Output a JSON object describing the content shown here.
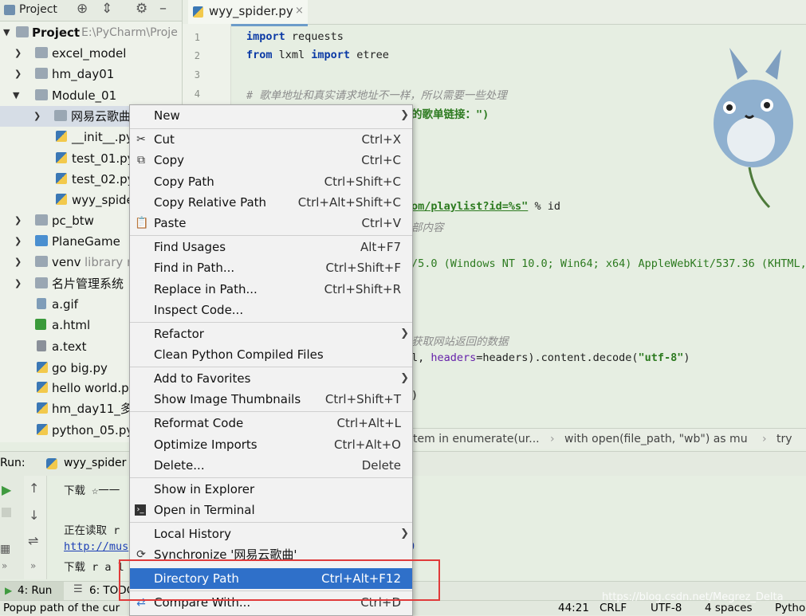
{
  "project_panel": {
    "title": "Project",
    "root_label": "Project",
    "root_path": "E:\\PyCharm\\Proje",
    "items": [
      {
        "label": "excel_model",
        "kind": "folder"
      },
      {
        "label": "hm_day01",
        "kind": "folder"
      },
      {
        "label": "Module_01",
        "kind": "folder"
      },
      {
        "label": "网易云歌曲",
        "kind": "folder"
      },
      {
        "label": "__init__.py",
        "kind": "py"
      },
      {
        "label": "test_01.py",
        "kind": "py"
      },
      {
        "label": "test_02.py",
        "kind": "py"
      },
      {
        "label": "wyy_spide",
        "kind": "py"
      },
      {
        "label": "pc_btw",
        "kind": "folder"
      },
      {
        "label": "PlaneGame",
        "kind": "folder"
      },
      {
        "label": "venv",
        "kind": "folder",
        "note": "library r"
      },
      {
        "label": "名片管理系统",
        "kind": "folder"
      },
      {
        "label": "a.gif",
        "kind": "file"
      },
      {
        "label": "a.html",
        "kind": "file"
      },
      {
        "label": "a.text",
        "kind": "file"
      },
      {
        "label": "go big.py",
        "kind": "py"
      },
      {
        "label": "hello world.p",
        "kind": "py"
      },
      {
        "label": "hm_day11_多",
        "kind": "py"
      },
      {
        "label": "python_05.py",
        "kind": "py"
      }
    ]
  },
  "editor": {
    "tab_label": "wyy_spider.py",
    "line_numbers": [
      "1",
      "2",
      "3",
      "4"
    ],
    "code": {
      "l1_kw": "import",
      "l1_rest": " requests",
      "l2_kw1": "from",
      "l2_mid": " lxml ",
      "l2_kw2": "import",
      "l2_rest": " etree",
      "l4_comment": "# 歌单地址和真实请求地址不一样，所以需要一些处理",
      "l5_partial": "的歌单链接：\")",
      "l9_url": "om/playlist?id=%s\"",
      "l9_rest": " % id",
      "l10_comment": "部内容",
      "l12_partial": "/5.0 (Windows NT 10.0; Win64; x64) AppleWebKit/537.36 (KHTML,",
      "l15_comment": "获取网站返回的数据",
      "l16_a": "l, ",
      "l16_prm": "headers",
      "l16_b": "=headers).content.decode(",
      "l16_str": "\"utf-8\"",
      "l16_c": ")",
      "l18_partial": ")"
    },
    "breadcrumb": [
      "tem in enumerate(ur...",
      "with open(file_path, \"wb\") as mu",
      "try"
    ]
  },
  "run_panel": {
    "label": "Run:",
    "config_name": "wyy_spider",
    "lines": [
      "下载 ☆一一",
      "",
      "正在读取 r",
      "http://mus",
      "下载 r a l"
    ]
  },
  "bottom_tabs": [
    "4: Run",
    "6: TODO"
  ],
  "statusbar": {
    "message": "Popup path of the cur",
    "position": "44:21",
    "line_sep": "CRLF",
    "encoding": "UTF-8",
    "indent": "4 spaces",
    "interpreter": "Pytho"
  },
  "context_menu": {
    "items": [
      {
        "label": "New",
        "shortcut": "",
        "submenu": true,
        "icon": ""
      },
      {
        "sep": true
      },
      {
        "label": "Cut",
        "shortcut": "Ctrl+X",
        "icon": "scissors-icon"
      },
      {
        "label": "Copy",
        "shortcut": "Ctrl+C",
        "icon": "copy-icon"
      },
      {
        "label": "Copy Path",
        "shortcut": "Ctrl+Shift+C",
        "icon": ""
      },
      {
        "label": "Copy Relative Path",
        "shortcut": "Ctrl+Alt+Shift+C",
        "icon": ""
      },
      {
        "label": "Paste",
        "shortcut": "Ctrl+V",
        "icon": "clipboard-icon"
      },
      {
        "sep": true
      },
      {
        "label": "Find Usages",
        "shortcut": "Alt+F7",
        "icon": ""
      },
      {
        "label": "Find in Path...",
        "shortcut": "Ctrl+Shift+F",
        "icon": ""
      },
      {
        "label": "Replace in Path...",
        "shortcut": "Ctrl+Shift+R",
        "icon": ""
      },
      {
        "label": "Inspect Code...",
        "shortcut": "",
        "icon": ""
      },
      {
        "sep": true
      },
      {
        "label": "Refactor",
        "shortcut": "",
        "submenu": true,
        "icon": ""
      },
      {
        "label": "Clean Python Compiled Files",
        "shortcut": "",
        "icon": ""
      },
      {
        "sep": true
      },
      {
        "label": "Add to Favorites",
        "shortcut": "",
        "submenu": true,
        "icon": ""
      },
      {
        "label": "Show Image Thumbnails",
        "shortcut": "Ctrl+Shift+T",
        "icon": ""
      },
      {
        "sep": true
      },
      {
        "label": "Reformat Code",
        "shortcut": "Ctrl+Alt+L",
        "icon": ""
      },
      {
        "label": "Optimize Imports",
        "shortcut": "Ctrl+Alt+O",
        "icon": ""
      },
      {
        "label": "Delete...",
        "shortcut": "Delete",
        "icon": ""
      },
      {
        "sep": true
      },
      {
        "label": "Show in Explorer",
        "shortcut": "",
        "icon": ""
      },
      {
        "label": "Open in Terminal",
        "shortcut": "",
        "icon": "terminal-icon"
      },
      {
        "sep": true
      },
      {
        "label": "Local History",
        "shortcut": "",
        "submenu": true,
        "icon": ""
      },
      {
        "label": "Synchronize '网易云歌曲'",
        "shortcut": "",
        "icon": "sync-icon"
      },
      {
        "label": "Directory Path",
        "shortcut": "Ctrl+Alt+F12",
        "icon": "",
        "selected": true
      },
      {
        "sep": true
      },
      {
        "label": "Compare With...",
        "shortcut": "Ctrl+D",
        "icon": "compare-icon"
      }
    ]
  },
  "watermark": "https://blog.csdn.net/Megrez_Delta",
  "colors": {
    "selection": "#2f70c9",
    "highlight_box": "#e03a3a",
    "keyword": "#0b3aa5",
    "string": "#2c7a1f"
  }
}
